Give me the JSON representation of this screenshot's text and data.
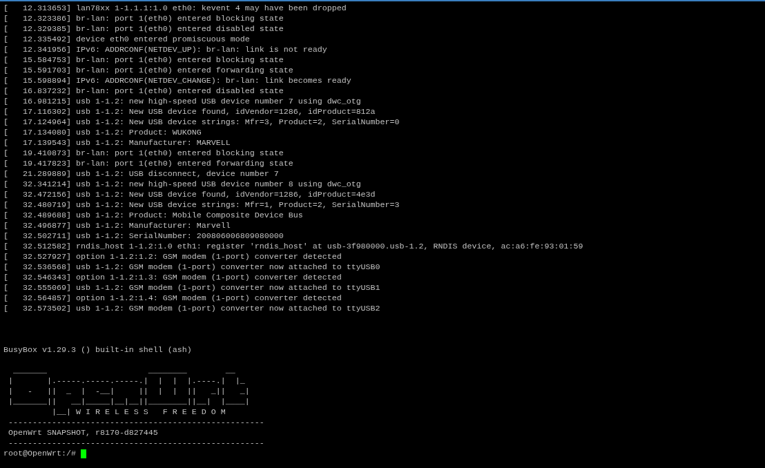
{
  "terminal": {
    "lines": [
      {
        "kind": "log",
        "text": "[   12.313653] lan78xx 1-1.1.1:1.0 eth0: kevent 4 may have been dropped"
      },
      {
        "kind": "log",
        "text": "[   12.323386] br-lan: port 1(eth0) entered blocking state"
      },
      {
        "kind": "log",
        "text": "[   12.329385] br-lan: port 1(eth0) entered disabled state"
      },
      {
        "kind": "log",
        "text": "[   12.335492] device eth0 entered promiscuous mode"
      },
      {
        "kind": "log",
        "text": "[   12.341956] IPv6: ADDRCONF(NETDEV_UP): br-lan: link is not ready"
      },
      {
        "kind": "log",
        "text": "[   15.584753] br-lan: port 1(eth0) entered blocking state"
      },
      {
        "kind": "log",
        "text": "[   15.591703] br-lan: port 1(eth0) entered forwarding state"
      },
      {
        "kind": "log",
        "text": "[   15.598894] IPv6: ADDRCONF(NETDEV_CHANGE): br-lan: link becomes ready"
      },
      {
        "kind": "log",
        "text": "[   16.837232] br-lan: port 1(eth0) entered disabled state"
      },
      {
        "kind": "log",
        "text": "[   16.981215] usb 1-1.2: new high-speed USB device number 7 using dwc_otg"
      },
      {
        "kind": "log",
        "text": "[   17.116302] usb 1-1.2: New USB device found, idVendor=1286, idProduct=812a"
      },
      {
        "kind": "log",
        "text": "[   17.124964] usb 1-1.2: New USB device strings: Mfr=3, Product=2, SerialNumber=0"
      },
      {
        "kind": "log",
        "text": "[   17.134080] usb 1-1.2: Product: WUKONG"
      },
      {
        "kind": "log",
        "text": "[   17.139543] usb 1-1.2: Manufacturer: MARVELL"
      },
      {
        "kind": "log",
        "text": "[   19.410873] br-lan: port 1(eth0) entered blocking state"
      },
      {
        "kind": "log",
        "text": "[   19.417823] br-lan: port 1(eth0) entered forwarding state"
      },
      {
        "kind": "log",
        "text": "[   21.289889] usb 1-1.2: USB disconnect, device number 7"
      },
      {
        "kind": "log",
        "text": "[   32.341214] usb 1-1.2: new high-speed USB device number 8 using dwc_otg"
      },
      {
        "kind": "log",
        "text": "[   32.472156] usb 1-1.2: New USB device found, idVendor=1286, idProduct=4e3d"
      },
      {
        "kind": "log",
        "text": "[   32.480719] usb 1-1.2: New USB device strings: Mfr=1, Product=2, SerialNumber=3"
      },
      {
        "kind": "log",
        "text": "[   32.489688] usb 1-1.2: Product: Mobile Composite Device Bus"
      },
      {
        "kind": "log",
        "text": "[   32.496877] usb 1-1.2: Manufacturer: Marvell"
      },
      {
        "kind": "log",
        "text": "[   32.502711] usb 1-1.2: SerialNumber: 200806006809080000"
      },
      {
        "kind": "log",
        "text": "[   32.512582] rndis_host 1-1.2:1.0 eth1: register 'rndis_host' at usb-3f980000.usb-1.2, RNDIS device, ac:a6:fe:93:01:59"
      },
      {
        "kind": "log",
        "text": "[   32.527927] option 1-1.2:1.2: GSM modem (1-port) converter detected"
      },
      {
        "kind": "log",
        "text": "[   32.536568] usb 1-1.2: GSM modem (1-port) converter now attached to ttyUSB0"
      },
      {
        "kind": "log",
        "text": "[   32.546343] option 1-1.2:1.3: GSM modem (1-port) converter detected"
      },
      {
        "kind": "log",
        "text": "[   32.555069] usb 1-1.2: GSM modem (1-port) converter now attached to ttyUSB1"
      },
      {
        "kind": "log",
        "text": "[   32.564857] option 1-1.2:1.4: GSM modem (1-port) converter detected"
      },
      {
        "kind": "log",
        "text": "[   32.573502] usb 1-1.2: GSM modem (1-port) converter now attached to ttyUSB2"
      },
      {
        "kind": "blank"
      },
      {
        "kind": "blank"
      },
      {
        "kind": "blank"
      },
      {
        "kind": "log",
        "text": "BusyBox v1.29.3 () built-in shell (ash)"
      },
      {
        "kind": "blank"
      },
      {
        "kind": "banner",
        "text": "  _______                     ________        __"
      },
      {
        "kind": "banner",
        "text": " |       |.-----.-----.-----.|  |  |  |.----.|  |_"
      },
      {
        "kind": "banner",
        "text": " |   -   ||  _  |  -__|     ||  |  |  ||   _||   _|"
      },
      {
        "kind": "banner",
        "text": " |_______||   __|_____|__|__||________||__|  |____|"
      },
      {
        "kind": "banner",
        "text": "          |__| W I R E L E S S   F R E E D O M"
      },
      {
        "kind": "rule",
        "text": " -----------------------------------------------------"
      },
      {
        "kind": "log",
        "text": " OpenWrt SNAPSHOT, r8170-d827445"
      },
      {
        "kind": "rule",
        "text": " -----------------------------------------------------"
      },
      {
        "kind": "prompt",
        "text": "root@OpenWrt:/# "
      }
    ]
  }
}
